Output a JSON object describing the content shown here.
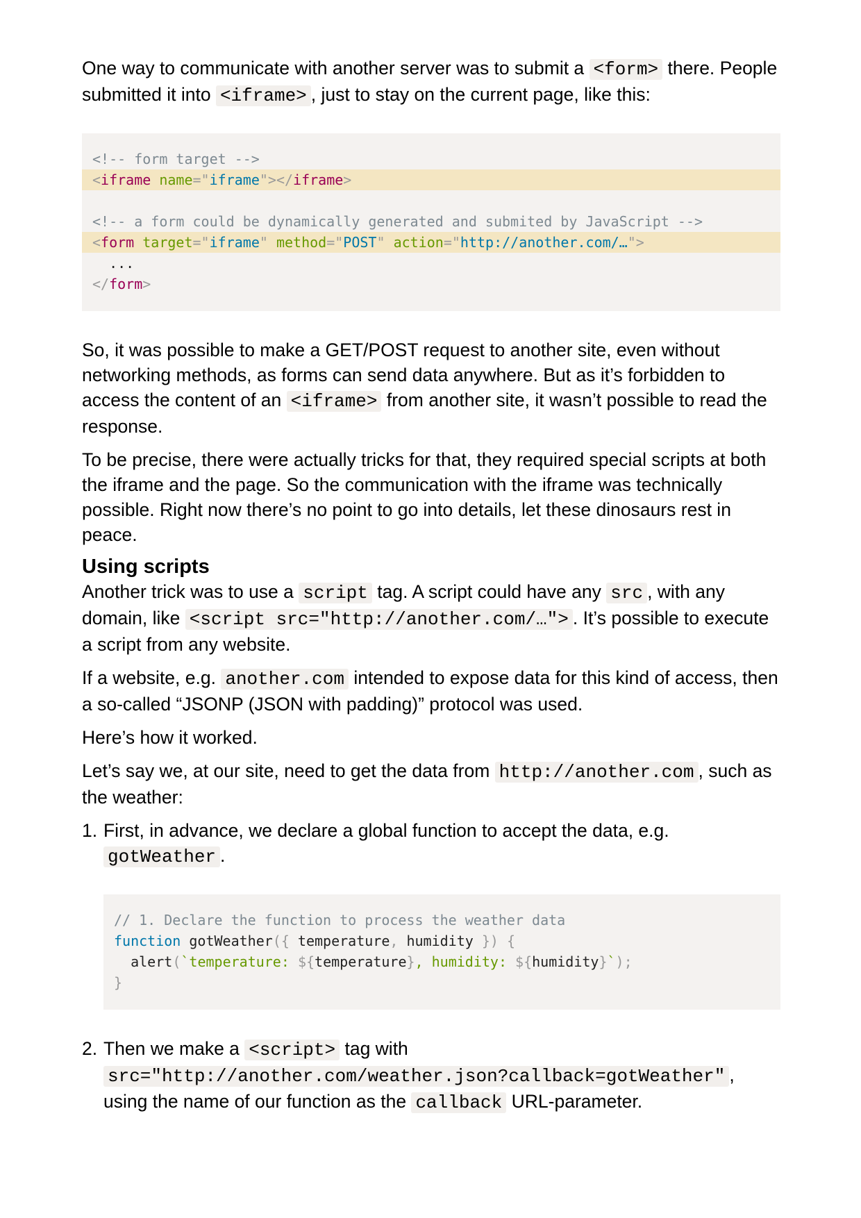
{
  "p1": {
    "t1": "One way to communicate with another server was to submit a ",
    "c1": "<form>",
    "t2": " there. People submitted it into ",
    "c2": "<iframe>",
    "t3": ", just to stay on the current page, like this:"
  },
  "code1": {
    "l1": "<!-- form target -->",
    "l2_open": "<",
    "l2_tag": "iframe",
    "l2_attr": "name",
    "l2_eq": "=\"",
    "l2_val": "iframe",
    "l2_mid": "\"></",
    "l2_tag2": "iframe",
    "l2_close": ">",
    "l4": "<!-- a form could be dynamically generated and submited by JavaScript -->",
    "l5_open": "<",
    "l5_tag": "form",
    "l5_a1": "target",
    "l5_v1": "iframe",
    "l5_a2": "method",
    "l5_v2": "POST",
    "l5_a3": "action",
    "l5_v3": "http://another.com/…",
    "l6": "  ...",
    "l7_open": "</",
    "l7_tag": "form",
    "l7_close": ">"
  },
  "p2": {
    "t1": "So, it was possible to make a GET/POST request to another site, even without networking methods, as forms can send data anywhere. But as it’s forbidden to access the content of an ",
    "c1": "<iframe>",
    "t2": " from another site, it wasn’t possible to read the response."
  },
  "p3": "To be precise, there were actually tricks for that, they required special scripts at both the iframe and the page. So the communication with the iframe was technically possible. Right now there’s no point to go into details, let these dinosaurs rest in peace.",
  "heading": "Using scripts",
  "p4": {
    "t1": "Another trick was to use a ",
    "c1": "script",
    "t2": " tag. A script could have any ",
    "c2": "src",
    "t3": ", with any domain, like ",
    "c3": "<script src=\"http://another.com/…\">",
    "t4": ". It’s possible to execute a script from any website."
  },
  "p5": {
    "t1": "If a website, e.g. ",
    "c1": "another.com",
    "t2": " intended to expose data for this kind of access, then a so-called “JSONP (JSON with padding)” protocol was used."
  },
  "p6": "Here’s how it worked.",
  "p7": {
    "t1": "Let’s say we, at our site, need to get the data from ",
    "c1": "http://another.com",
    "t2": ", such as the weather:"
  },
  "list": {
    "n1": "1.",
    "i1_t1": "First, in advance, we declare a global function to accept the data, e.g. ",
    "i1_c1": "gotWeather",
    "i1_t2": ".",
    "n2": "2.",
    "i2_t1": "Then we make a ",
    "i2_c1": "<script>",
    "i2_t2": " tag with ",
    "i2_c2": "src=\"http://another.com/weather.json?callback=gotWeather\"",
    "i2_t3": ", using the name of our function as the ",
    "i2_c3": "callback",
    "i2_t4": " URL-parameter."
  },
  "code2": {
    "l1": "// 1. Declare the function to process the weather data",
    "l2_kw": "function",
    "l2_name": " gotWeather",
    "l2_p1": "({",
    "l2_a1": " temperature",
    "l2_comma": ",",
    "l2_a2": " humidity ",
    "l2_p2": "}) {",
    "l3_indent": "  ",
    "l3_fn": "alert",
    "l3_p1": "(",
    "l3_s1": "`temperature: ",
    "l3_d1": "${",
    "l3_v1": "temperature",
    "l3_d2": "}",
    "l3_s2": ", humidity: ",
    "l3_d3": "${",
    "l3_v2": "humidity",
    "l3_d4": "}",
    "l3_s3": "`",
    "l3_p2": ");",
    "l4": "}"
  }
}
